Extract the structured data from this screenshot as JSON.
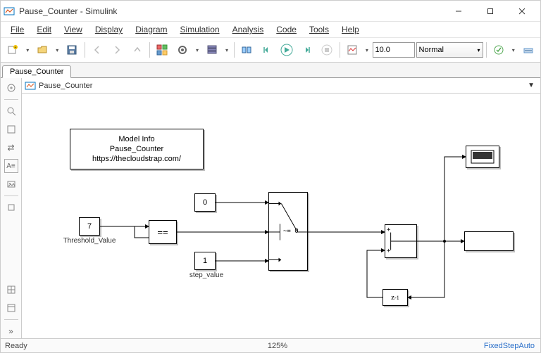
{
  "window": {
    "title": "Pause_Counter - Simulink"
  },
  "menus": {
    "file": "File",
    "edit": "Edit",
    "view": "View",
    "display": "Display",
    "diagram": "Diagram",
    "simulation": "Simulation",
    "analysis": "Analysis",
    "code": "Code",
    "tools": "Tools",
    "help": "Help"
  },
  "toolbar": {
    "sim_time": "10.0",
    "sim_mode": "Normal"
  },
  "tab": {
    "label": "Pause_Counter"
  },
  "breadcrumb": {
    "label": "Pause_Counter"
  },
  "blocks": {
    "model_info_line1": "Model Info",
    "model_info_line2": "Pause_Counter",
    "model_info_line3": "https://thecloudstrap.com/",
    "threshold_const": "7",
    "threshold_label": "Threshold_Value",
    "compare_op": "==",
    "zero_const": "0",
    "one_const": "1",
    "one_label": "step_value",
    "switch_cond": "~= 0",
    "sum_plus1": "+",
    "sum_plus2": "+",
    "delay_label": "z",
    "delay_exp": "-1"
  },
  "status": {
    "ready": "Ready",
    "zoom": "125%",
    "solver": "FixedStepAuto"
  }
}
